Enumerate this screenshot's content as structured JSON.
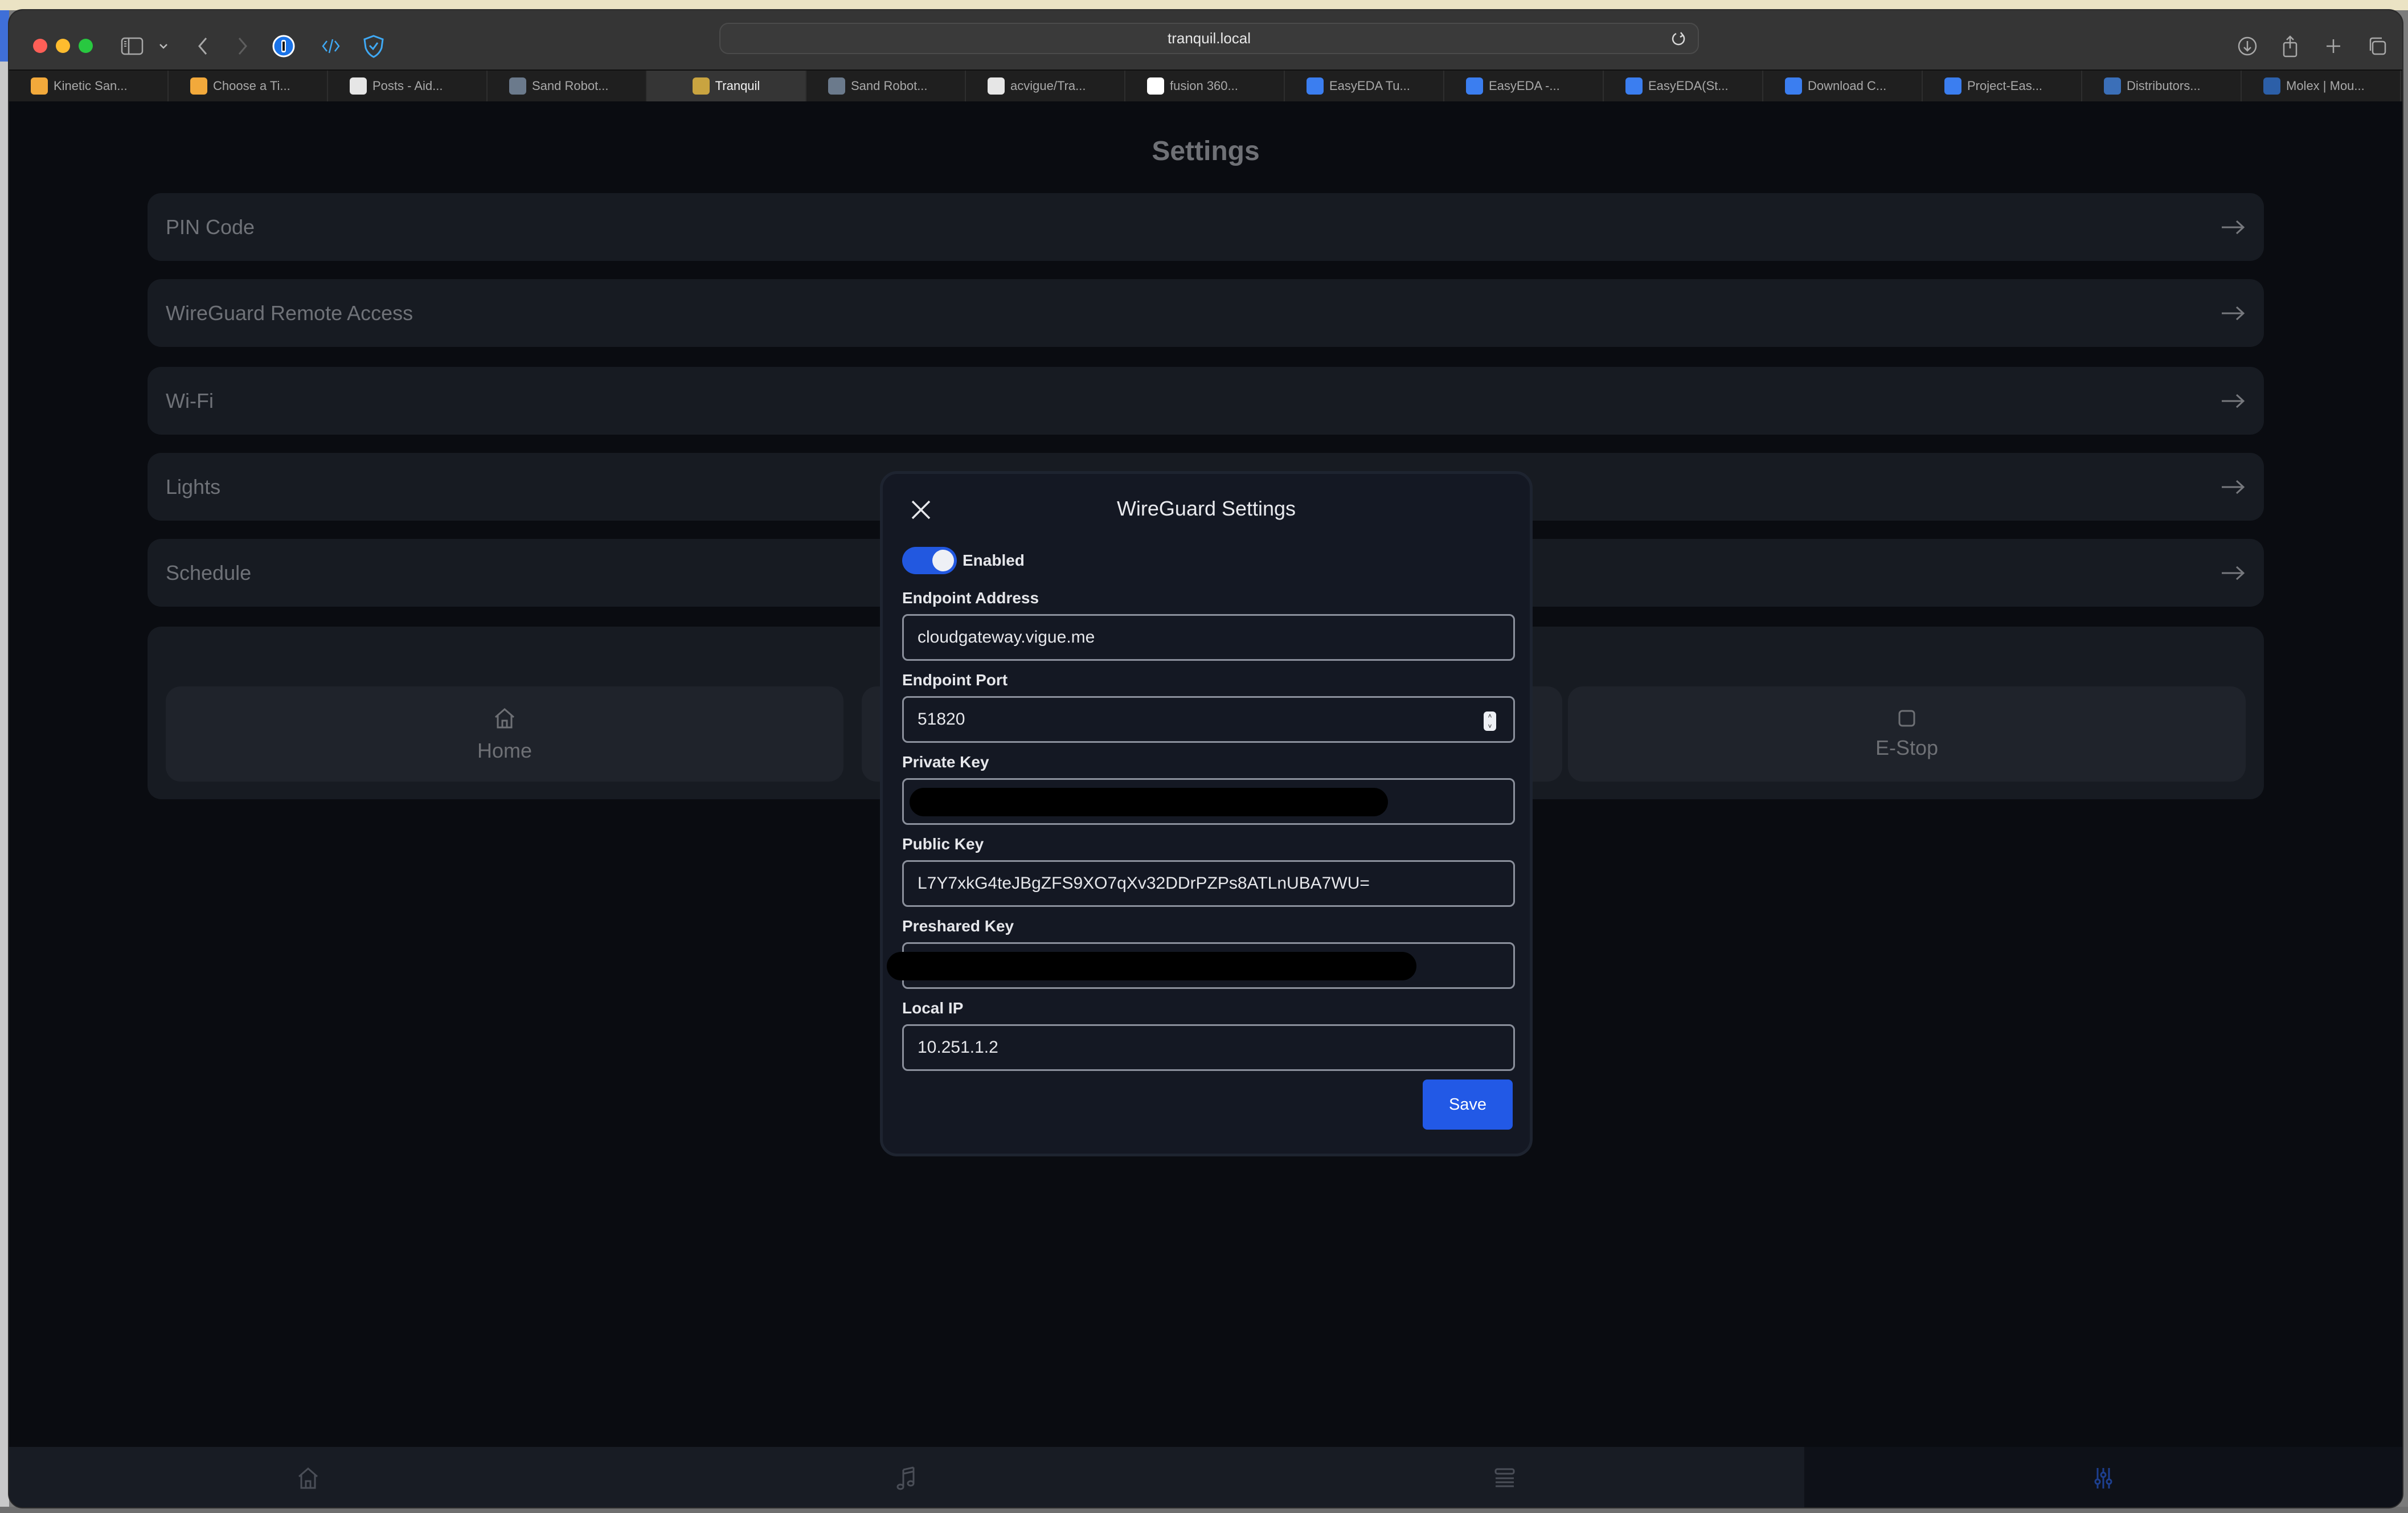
{
  "browser": {
    "url": "tranquil.local",
    "tabs": [
      {
        "label": "Kinetic San...",
        "favicon": "robot-favicon",
        "color": "#f2a93b"
      },
      {
        "label": "Choose a Ti...",
        "favicon": "robot-favicon",
        "color": "#f2a93b"
      },
      {
        "label": "Posts - Aid...",
        "favicon": "circle-favicon",
        "color": "#e6e6e6"
      },
      {
        "label": "Sand Robot...",
        "favicon": "photo-favicon",
        "color": "#6b7a8c"
      },
      {
        "label": "Tranquil",
        "favicon": "lotus-favicon",
        "color": "#c9a440",
        "active": true
      },
      {
        "label": "Sand Robot...",
        "favicon": "photo-favicon",
        "color": "#6b7a8c"
      },
      {
        "label": "acvigue/Tra...",
        "favicon": "github-favicon",
        "color": "#e6e6e6"
      },
      {
        "label": "fusion 360...",
        "favicon": "google-favicon",
        "color": "#ffffff"
      },
      {
        "label": "EasyEDA Tu...",
        "favicon": "easyeda-favicon",
        "color": "#3b7ef0"
      },
      {
        "label": "EasyEDA -...",
        "favicon": "easyeda-favicon",
        "color": "#3b7ef0"
      },
      {
        "label": "EasyEDA(St...",
        "favicon": "easyeda-favicon",
        "color": "#3b7ef0"
      },
      {
        "label": "Download C...",
        "favicon": "easyeda-favicon",
        "color": "#3b7ef0"
      },
      {
        "label": "Project-Eas...",
        "favicon": "easyeda-favicon",
        "color": "#3b7ef0"
      },
      {
        "label": "Distributors...",
        "favicon": "gear-favicon",
        "color": "#3b6fb8"
      },
      {
        "label": "Molex | Mou...",
        "favicon": "mouser-favicon",
        "color": "#2c5fa8"
      }
    ]
  },
  "page": {
    "title": "Settings",
    "rows": [
      {
        "label": "PIN Code"
      },
      {
        "label": "WireGuard Remote Access"
      },
      {
        "label": "Wi-Fi"
      },
      {
        "label": "Lights"
      },
      {
        "label": "Schedule"
      }
    ],
    "controls": {
      "home_label": "Home",
      "estop_label": "E-Stop"
    }
  },
  "modal": {
    "title": "WireGuard Settings",
    "enabled_label": "Enabled",
    "enabled": true,
    "fields": {
      "endpoint_address": {
        "label": "Endpoint Address",
        "value": "cloudgateway.vigue.me"
      },
      "endpoint_port": {
        "label": "Endpoint Port",
        "value": "51820"
      },
      "private_key": {
        "label": "Private Key",
        "value": "[redacted]"
      },
      "public_key": {
        "label": "Public Key",
        "value": "L7Y7xkG4teJBgZFS9XO7qXv32DDrPZPs8ATLnUBA7WU="
      },
      "preshared_key": {
        "label": "Preshared Key",
        "value": "[redacted]"
      },
      "local_ip": {
        "label": "Local IP",
        "value": "10.251.1.2"
      }
    },
    "save_label": "Save"
  },
  "bottom_nav": {
    "items": [
      {
        "name": "home",
        "icon": "home-icon"
      },
      {
        "name": "music",
        "icon": "music-note-icon"
      },
      {
        "name": "playlist",
        "icon": "list-icon"
      },
      {
        "name": "settings",
        "icon": "sliders-icon",
        "active": true
      }
    ],
    "active_color": "#1d3f8f"
  }
}
